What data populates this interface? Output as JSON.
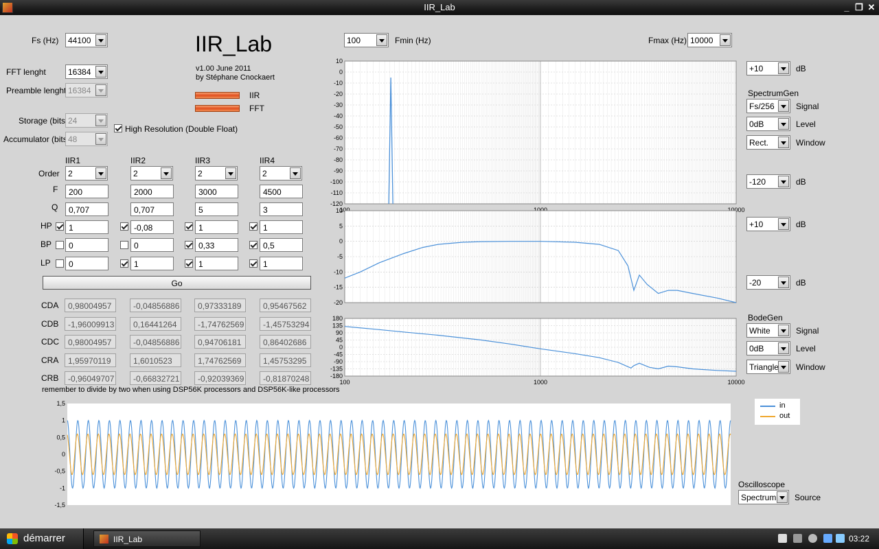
{
  "window": {
    "title": "IIR_Lab"
  },
  "app": {
    "title": "IIR_Lab",
    "version": "v1.00 June 2011",
    "author": "by Stéphane Cnockaert",
    "led_iir": "IIR",
    "led_fft": "FFT"
  },
  "settings": {
    "fs_label": "Fs (Hz)",
    "fs_value": "44100",
    "fft_label": "FFT lenght",
    "fft_value": "16384",
    "preamble_label": "Preamble lenght",
    "preamble_value": "16384",
    "storage_label": "Storage (bits)",
    "storage_value": "24",
    "acc_label": "Accumulator (bits)",
    "acc_value": "48",
    "highres_label": "High Resolution (Double Float)"
  },
  "filters": {
    "row_labels": {
      "order": "Order",
      "f": "F",
      "q": "Q",
      "hp": "HP",
      "bp": "BP",
      "lp": "LP"
    },
    "columns": [
      {
        "name": "IIR1",
        "order": "2",
        "f": "200",
        "q": "0,707",
        "hp": "1",
        "bp": "0",
        "lp": "0",
        "hp_on": true,
        "bp_on": false,
        "lp_on": false
      },
      {
        "name": "IIR2",
        "order": "2",
        "f": "2000",
        "q": "0,707",
        "hp": "-0,08",
        "bp": "0",
        "lp": "1",
        "hp_on": true,
        "bp_on": false,
        "lp_on": true
      },
      {
        "name": "IIR3",
        "order": "2",
        "f": "3000",
        "q": "5",
        "hp": "1",
        "bp": "0,33",
        "lp": "1",
        "hp_on": true,
        "bp_on": true,
        "lp_on": true
      },
      {
        "name": "IIR4",
        "order": "2",
        "f": "4500",
        "q": "3",
        "hp": "1",
        "bp": "0,5",
        "lp": "1",
        "hp_on": true,
        "bp_on": true,
        "lp_on": true
      }
    ],
    "go_label": "Go"
  },
  "coefficients": {
    "rows": [
      {
        "label": "CDA",
        "values": [
          "0,98004957",
          "-0,04856886",
          "0,97333189",
          "0,95467562"
        ]
      },
      {
        "label": "CDB",
        "values": [
          "-1,96009913",
          "0,16441264",
          "-1,74762569",
          "-1,45753294"
        ]
      },
      {
        "label": "CDC",
        "values": [
          "0,98004957",
          "-0,04856886",
          "0,94706181",
          "0,86402686"
        ]
      },
      {
        "label": "CRA",
        "values": [
          "1,95970119",
          "1,6010523",
          "1,74762569",
          "1,45753295"
        ]
      },
      {
        "label": "CRB",
        "values": [
          "-0,96049707",
          "-0,66832721",
          "-0,92039369",
          "-0,81870248"
        ]
      }
    ],
    "note": "remember to divide by two when using DSP56K processors and DSP56K-like processors"
  },
  "freq": {
    "fmin_label": "Fmin (Hz)",
    "fmin_value": "100",
    "fmax_label": "Fmax (Hz)",
    "fmax_value": "10000"
  },
  "right_panel": {
    "spec_top_db": "+10",
    "spec_bottom_db": "-120",
    "db_unit": "dB",
    "spectrumgen_label": "SpectrumGen",
    "spec_signal": "Fs/256",
    "spec_level": "0dB",
    "spec_window": "Rect.",
    "signal_label": "Signal",
    "level_label": "Level",
    "window_label": "Window",
    "mag_top_db": "+10",
    "mag_bottom_db": "-20",
    "bodegen_label": "BodeGen",
    "bode_signal": "White",
    "bode_level": "0dB",
    "bode_window": "Triangle",
    "osc_label": "Oscilloscope",
    "osc_source": "Spectrum",
    "source_label": "Source"
  },
  "legend": {
    "in": "in",
    "out": "out"
  },
  "colors": {
    "series_in": "#4a90d9",
    "series_out": "#f0a830"
  },
  "chart_data": [
    {
      "type": "line",
      "name": "spectrum",
      "x_scale": "log",
      "xlim": [
        100,
        10000
      ],
      "ylim": [
        -120,
        10
      ],
      "x_ticks": [
        "100",
        "1000",
        "10000"
      ],
      "y_ticks": [
        "10",
        "0",
        "-10",
        "-20",
        "-30",
        "-40",
        "-50",
        "-60",
        "-70",
        "-80",
        "-90",
        "-100",
        "-110",
        "-120"
      ],
      "peak": {
        "x": 172,
        "y": -5
      }
    },
    {
      "type": "line",
      "name": "magnitude",
      "x_scale": "log",
      "xlim": [
        100,
        10000
      ],
      "ylim": [
        -20,
        10
      ],
      "x_ticks": [],
      "y_ticks": [
        "10",
        "5",
        "0",
        "-5",
        "-10",
        "-15",
        "-20"
      ],
      "x": [
        100,
        120,
        150,
        200,
        250,
        300,
        400,
        500,
        700,
        1000,
        1500,
        2000,
        2500,
        2800,
        3000,
        3200,
        3500,
        4000,
        4500,
        5000,
        6000,
        8000,
        10000
      ],
      "y": [
        -12,
        -10,
        -7,
        -4,
        -2,
        -1,
        -0.3,
        -0.1,
        0,
        0,
        -0.3,
        -1,
        -3,
        -8,
        -16,
        -11,
        -14,
        -17,
        -16,
        -16,
        -17,
        -18.5,
        -20
      ]
    },
    {
      "type": "line",
      "name": "phase",
      "x_scale": "log",
      "xlim": [
        100,
        10000
      ],
      "ylim": [
        -180,
        180
      ],
      "x_ticks": [
        "100",
        "1000",
        "10000"
      ],
      "y_ticks": [
        "180",
        "135",
        "90",
        "45",
        "0",
        "-45",
        "-90",
        "-135",
        "-180"
      ],
      "x": [
        100,
        150,
        200,
        300,
        500,
        700,
        1000,
        1500,
        2000,
        2500,
        2900,
        3000,
        3200,
        3600,
        4000,
        4500,
        5000,
        6000,
        8000,
        10000
      ],
      "y": [
        130,
        110,
        95,
        75,
        45,
        20,
        -10,
        -40,
        -65,
        -95,
        -130,
        -115,
        -100,
        -125,
        -135,
        -118,
        -122,
        -135,
        -145,
        -150
      ]
    },
    {
      "type": "line",
      "name": "oscilloscope",
      "ylim": [
        -1.5,
        1.5
      ],
      "y_ticks": [
        "1,5",
        "1",
        "0,5",
        "0",
        "-0,5",
        "-1",
        "-1,5"
      ],
      "series": [
        {
          "name": "in",
          "amplitude": 1.0,
          "cycles": 63
        },
        {
          "name": "out",
          "amplitude": 0.6,
          "cycles": 63
        }
      ]
    }
  ]
}
